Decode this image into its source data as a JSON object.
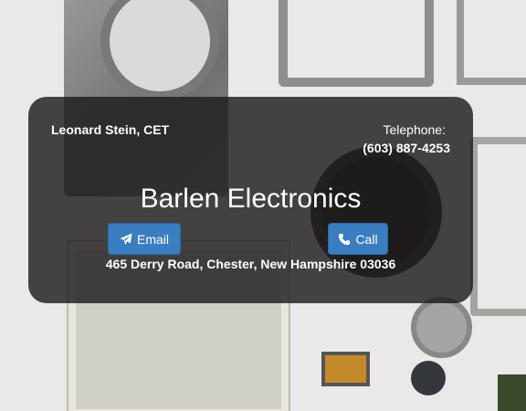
{
  "contact": {
    "technician": "Leonard Stein, CET",
    "telephone_label": "Telephone:",
    "telephone_number": "(603) 887-4253"
  },
  "company": {
    "name": "Barlen Electronics",
    "address": "465 Derry Road, Chester, New Hampshire 03036"
  },
  "actions": {
    "email_label": "Email",
    "email_icon": "paper-plane-icon",
    "call_label": "Call",
    "call_icon": "phone-icon"
  },
  "colors": {
    "button": "#3a7dc0",
    "overlay": "rgba(30,28,28,0.82)",
    "text": "#ffffff"
  }
}
